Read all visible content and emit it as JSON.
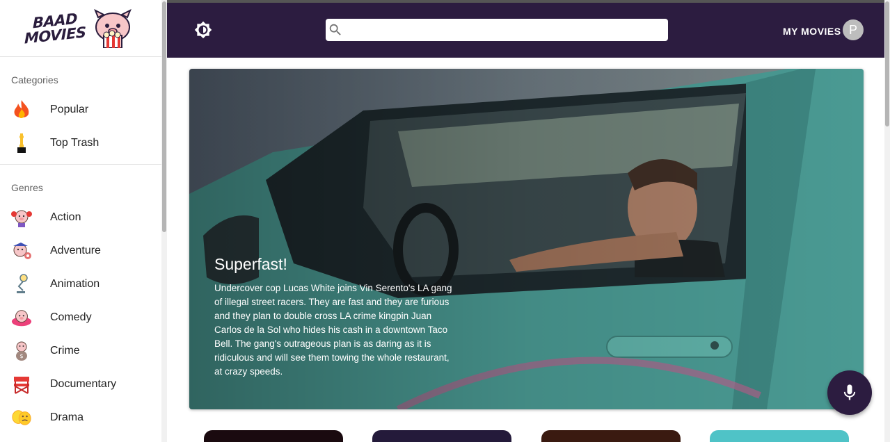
{
  "logo": {
    "line1": "BAAD",
    "line2": "MOVIES"
  },
  "sidebar": {
    "categories_title": "Categories",
    "categories": [
      {
        "label": "Popular",
        "icon": "fire-icon"
      },
      {
        "label": "Top Trash",
        "icon": "trophy-icon"
      }
    ],
    "genres_title": "Genres",
    "genres": [
      {
        "label": "Action",
        "icon": "pig-boxing-icon"
      },
      {
        "label": "Adventure",
        "icon": "pig-adventure-icon"
      },
      {
        "label": "Animation",
        "icon": "lamp-icon"
      },
      {
        "label": "Comedy",
        "icon": "pig-donut-icon"
      },
      {
        "label": "Crime",
        "icon": "pig-moneybag-icon"
      },
      {
        "label": "Documentary",
        "icon": "directors-chair-icon"
      },
      {
        "label": "Drama",
        "icon": "theater-masks-icon"
      }
    ]
  },
  "header": {
    "my_movies": "MY MOVIES",
    "avatar_letter": "P",
    "search_placeholder": ""
  },
  "hero": {
    "title": "Superfast!",
    "description": "Undercover cop Lucas White joins Vin Serento's LA gang of illegal street racers. They are fast and they are furious and they plan to double cross LA crime kingpin Juan Carlos de la Sol who hides his cash in a downtown Taco Bell. The gang's outrageous plan is as daring as it is ridiculous and will see them towing the whole restaurant, at crazy speeds."
  },
  "colors": {
    "brand": "#2c1c40",
    "accent_teal": "#4a9a93"
  }
}
